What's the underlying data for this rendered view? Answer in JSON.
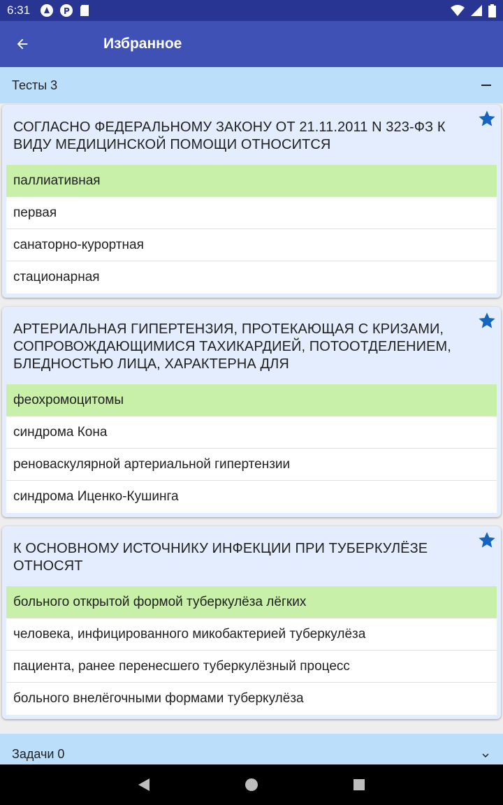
{
  "status_bar": {
    "time": "6:31"
  },
  "app_bar": {
    "title": "Избранное"
  },
  "sections": {
    "tests": {
      "label": "Тесты 3"
    },
    "tasks": {
      "label": "Задачи 0"
    }
  },
  "questions": [
    {
      "text": "СОГЛАСНО ФЕДЕРАЛЬНОМУ ЗАКОНУ ОТ 21.11.2011 N 323-ФЗ К ВИДУ МЕДИЦИНСКОЙ ПОМОЩИ ОТНОСИТСЯ",
      "answers": [
        "паллиативная",
        "первая",
        "санаторно-курортная",
        "стационарная"
      ],
      "correct_index": 0
    },
    {
      "text": "АРТЕРИАЛЬНАЯ ГИПЕРТЕНЗИЯ, ПРОТЕКАЮЩАЯ С КРИЗАМИ, СОПРОВОЖДАЮЩИМИСЯ ТАХИКАРДИЕЙ, ПОТООТДЕЛЕНИЕМ, БЛЕДНОСТЬЮ ЛИЦА, ХАРАКТЕРНА ДЛЯ",
      "answers": [
        "феохромоцитомы",
        "синдрома Кона",
        "реноваскулярной артериальной гипертензии",
        "синдрома Иценко-Кушинга"
      ],
      "correct_index": 0
    },
    {
      "text": "К ОСНОВНОМУ ИСТОЧНИКУ ИНФЕКЦИИ ПРИ ТУБЕРКУЛЁЗЕ ОТНОСЯТ",
      "answers": [
        "больного открытой формой туберкулёза лёгких",
        "человека, инфицированного микобактерией туберкулёза",
        "пациента, ранее перенесшего туберкулёзный процесс",
        "больного внелёгочными формами туберкулёза"
      ],
      "correct_index": 0
    }
  ],
  "colors": {
    "status_bar": "#283593",
    "app_bar": "#3f51b5",
    "section_header": "#bbdefb",
    "card_bg": "#e3edfd",
    "correct_answer": "#c8f0a8",
    "star": "#1565c0"
  },
  "icons": {
    "back": "arrow-back-icon",
    "collapse": "minus-icon",
    "expand": "chevron-down-icon",
    "favorite": "star-icon"
  }
}
